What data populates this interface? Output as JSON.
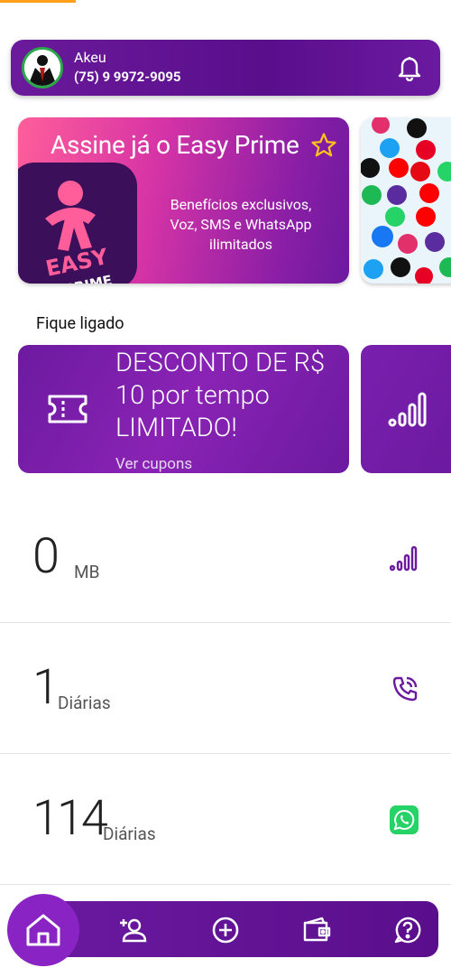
{
  "user": {
    "name": "Akeu",
    "phone": "(75) 9 9972-9095"
  },
  "promo": {
    "title": "Assine já o Easy Prime",
    "description": "Benefícios exclusivos, Voz, SMS e WhatsApp ilimitados",
    "logo_text_1": "EASY",
    "logo_text_2": "PRIME"
  },
  "section": {
    "title": "Fique ligado"
  },
  "coupon": {
    "text": "DESCONTO DE R$ 10 por tempo LIMITADO!",
    "link": "Ver cupons"
  },
  "stats": [
    {
      "value": "0",
      "unit": "MB",
      "icon": "signal-icon"
    },
    {
      "value": "1",
      "unit": "Diárias",
      "icon": "phone-call-icon"
    },
    {
      "value": "114",
      "unit": "Diárias",
      "icon": "whatsapp-icon"
    }
  ],
  "nav": {
    "items": [
      "home-icon",
      "add-user-icon",
      "plus-circle-icon",
      "wallet-icon",
      "help-icon"
    ]
  },
  "colors": {
    "primary": "#6b1aa0",
    "accent": "#ff9f1a",
    "whatsapp": "#25d366"
  }
}
